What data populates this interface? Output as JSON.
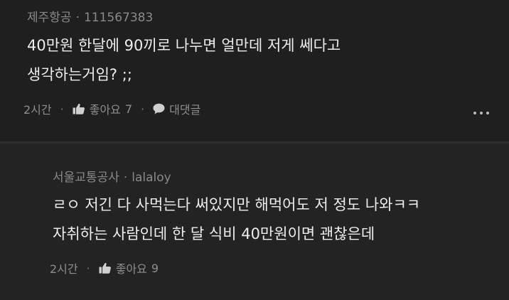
{
  "comments": [
    {
      "author": "제주항공",
      "separator": "·",
      "user_id": "111567383",
      "lines": [
        "40만원 한달에 90끼로 나누면 얼만데 저게 쎄다고",
        "생각하는거임? ;;"
      ],
      "time": "2시간",
      "like_label": "좋아요",
      "like_count": "7",
      "reply_label": "대댓글"
    },
    {
      "author": "서울교통공사",
      "separator": "·",
      "user_id": "lalaloy",
      "lines": [
        "ㄹㅇ 저긴 다 사먹는다 써있지만 해먹어도 저 정도 나와ㅋㅋ",
        "자취하는 사람인데 한 달 식비 40만원이면 괜찮은데"
      ],
      "time": "2시간",
      "like_label": "좋아요",
      "like_count": "9"
    }
  ],
  "icons": {
    "like": "thumbs-up-icon",
    "reply": "speech-bubble-icon",
    "more": "more-dots-icon"
  },
  "colors": {
    "background": "#1f1f1f",
    "reply_background": "#232323",
    "text": "#ededed",
    "meta": "#8a8a8a"
  }
}
